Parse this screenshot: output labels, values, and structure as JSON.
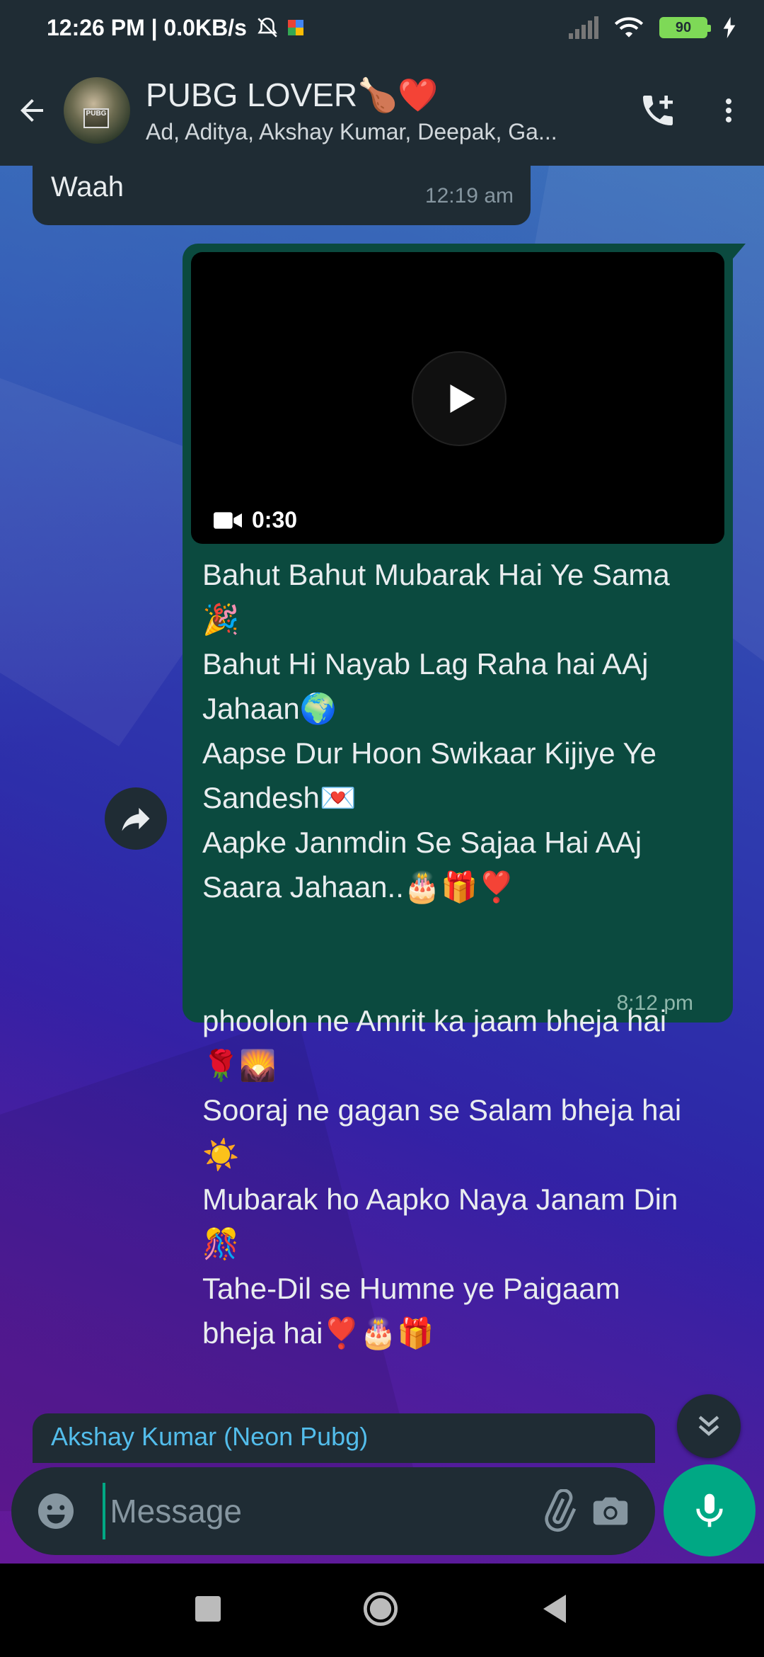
{
  "status_bar": {
    "time_info": "12:26 PM | 0.0KB/s",
    "battery": "90"
  },
  "header": {
    "title": "PUBG LOVER🍗❤️",
    "subtitle": "Ad, Aditya, Akshay Kumar, Deepak, Ga...",
    "avatar_text": "PUBG"
  },
  "messages": {
    "incoming": {
      "text": "Waah",
      "time": "12:19 am"
    },
    "outgoing": {
      "video_duration": "0:30",
      "text": "Bahut Bahut Mubarak Hai Ye Sama\n🎉\nBahut Hi Nayab Lag Raha hai AAj\nJahaan🌍\nAapse Dur Hoon Swikaar Kijiye Ye\nSandesh💌\nAapke Janmdin Se Sajaa Hai AAj\nSaara Jahaan..🎂🎁❣️\n\n\nphoolon ne Amrit ka jaam bheja hai\n🌹🌄\nSooraj ne gagan se Salam bheja hai\n☀️\nMubarak ho Aapko Naya Janam Din\n🎊\nTahe-Dil se Humne ye Paigaam\nbheja hai❣️🎂🎁",
      "time": "8:12 pm"
    },
    "next_sender": "Akshay Kumar (Neon Pubg)"
  },
  "input": {
    "placeholder": "Message"
  },
  "colors": {
    "header_bg": "#1f2c34",
    "outgoing_bubble": "#0b4a3f",
    "accent": "#00a884",
    "sender_name": "#53bdeb"
  },
  "icons": {
    "back": "arrow-left",
    "add_call": "phone-plus",
    "menu": "vertical-dots",
    "forward": "share-arrow",
    "emoji": "smiley",
    "attach": "paperclip",
    "camera": "camera",
    "mic": "microphone",
    "scroll": "double-chevron-down"
  }
}
